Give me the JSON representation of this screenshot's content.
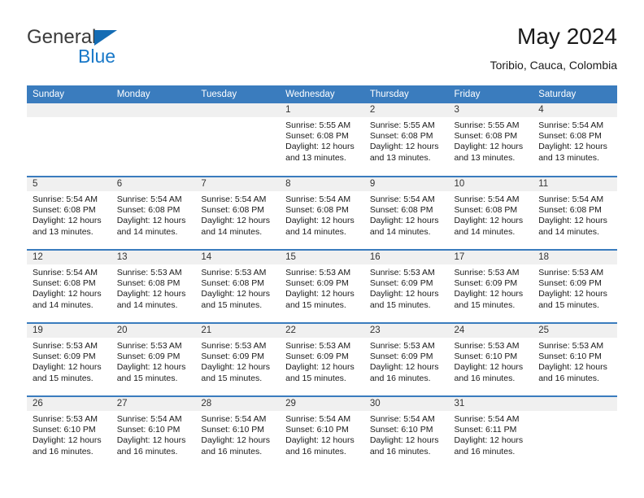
{
  "brand": {
    "name_top": "General",
    "name_bottom": "Blue",
    "triangle_color": "#146cb4",
    "blue_color": "#1878c8"
  },
  "header": {
    "title": "May 2024",
    "subtitle": "Toribio, Cauca, Colombia"
  },
  "theme": {
    "header_bg": "#3a7cbe",
    "header_text": "#ffffff",
    "daynum_bg": "#f0f0f0",
    "cell_bg": "#ffffff"
  },
  "weekdays": [
    "Sunday",
    "Monday",
    "Tuesday",
    "Wednesday",
    "Thursday",
    "Friday",
    "Saturday"
  ],
  "weeks": [
    [
      {
        "day": "",
        "empty": true
      },
      {
        "day": "",
        "empty": true
      },
      {
        "day": "",
        "empty": true
      },
      {
        "day": "1",
        "sunrise": "Sunrise: 5:55 AM",
        "sunset": "Sunset: 6:08 PM",
        "daylight1": "Daylight: 12 hours",
        "daylight2": "and 13 minutes."
      },
      {
        "day": "2",
        "sunrise": "Sunrise: 5:55 AM",
        "sunset": "Sunset: 6:08 PM",
        "daylight1": "Daylight: 12 hours",
        "daylight2": "and 13 minutes."
      },
      {
        "day": "3",
        "sunrise": "Sunrise: 5:55 AM",
        "sunset": "Sunset: 6:08 PM",
        "daylight1": "Daylight: 12 hours",
        "daylight2": "and 13 minutes."
      },
      {
        "day": "4",
        "sunrise": "Sunrise: 5:54 AM",
        "sunset": "Sunset: 6:08 PM",
        "daylight1": "Daylight: 12 hours",
        "daylight2": "and 13 minutes."
      }
    ],
    [
      {
        "day": "5",
        "sunrise": "Sunrise: 5:54 AM",
        "sunset": "Sunset: 6:08 PM",
        "daylight1": "Daylight: 12 hours",
        "daylight2": "and 13 minutes."
      },
      {
        "day": "6",
        "sunrise": "Sunrise: 5:54 AM",
        "sunset": "Sunset: 6:08 PM",
        "daylight1": "Daylight: 12 hours",
        "daylight2": "and 14 minutes."
      },
      {
        "day": "7",
        "sunrise": "Sunrise: 5:54 AM",
        "sunset": "Sunset: 6:08 PM",
        "daylight1": "Daylight: 12 hours",
        "daylight2": "and 14 minutes."
      },
      {
        "day": "8",
        "sunrise": "Sunrise: 5:54 AM",
        "sunset": "Sunset: 6:08 PM",
        "daylight1": "Daylight: 12 hours",
        "daylight2": "and 14 minutes."
      },
      {
        "day": "9",
        "sunrise": "Sunrise: 5:54 AM",
        "sunset": "Sunset: 6:08 PM",
        "daylight1": "Daylight: 12 hours",
        "daylight2": "and 14 minutes."
      },
      {
        "day": "10",
        "sunrise": "Sunrise: 5:54 AM",
        "sunset": "Sunset: 6:08 PM",
        "daylight1": "Daylight: 12 hours",
        "daylight2": "and 14 minutes."
      },
      {
        "day": "11",
        "sunrise": "Sunrise: 5:54 AM",
        "sunset": "Sunset: 6:08 PM",
        "daylight1": "Daylight: 12 hours",
        "daylight2": "and 14 minutes."
      }
    ],
    [
      {
        "day": "12",
        "sunrise": "Sunrise: 5:54 AM",
        "sunset": "Sunset: 6:08 PM",
        "daylight1": "Daylight: 12 hours",
        "daylight2": "and 14 minutes."
      },
      {
        "day": "13",
        "sunrise": "Sunrise: 5:53 AM",
        "sunset": "Sunset: 6:08 PM",
        "daylight1": "Daylight: 12 hours",
        "daylight2": "and 14 minutes."
      },
      {
        "day": "14",
        "sunrise": "Sunrise: 5:53 AM",
        "sunset": "Sunset: 6:08 PM",
        "daylight1": "Daylight: 12 hours",
        "daylight2": "and 15 minutes."
      },
      {
        "day": "15",
        "sunrise": "Sunrise: 5:53 AM",
        "sunset": "Sunset: 6:09 PM",
        "daylight1": "Daylight: 12 hours",
        "daylight2": "and 15 minutes."
      },
      {
        "day": "16",
        "sunrise": "Sunrise: 5:53 AM",
        "sunset": "Sunset: 6:09 PM",
        "daylight1": "Daylight: 12 hours",
        "daylight2": "and 15 minutes."
      },
      {
        "day": "17",
        "sunrise": "Sunrise: 5:53 AM",
        "sunset": "Sunset: 6:09 PM",
        "daylight1": "Daylight: 12 hours",
        "daylight2": "and 15 minutes."
      },
      {
        "day": "18",
        "sunrise": "Sunrise: 5:53 AM",
        "sunset": "Sunset: 6:09 PM",
        "daylight1": "Daylight: 12 hours",
        "daylight2": "and 15 minutes."
      }
    ],
    [
      {
        "day": "19",
        "sunrise": "Sunrise: 5:53 AM",
        "sunset": "Sunset: 6:09 PM",
        "daylight1": "Daylight: 12 hours",
        "daylight2": "and 15 minutes."
      },
      {
        "day": "20",
        "sunrise": "Sunrise: 5:53 AM",
        "sunset": "Sunset: 6:09 PM",
        "daylight1": "Daylight: 12 hours",
        "daylight2": "and 15 minutes."
      },
      {
        "day": "21",
        "sunrise": "Sunrise: 5:53 AM",
        "sunset": "Sunset: 6:09 PM",
        "daylight1": "Daylight: 12 hours",
        "daylight2": "and 15 minutes."
      },
      {
        "day": "22",
        "sunrise": "Sunrise: 5:53 AM",
        "sunset": "Sunset: 6:09 PM",
        "daylight1": "Daylight: 12 hours",
        "daylight2": "and 15 minutes."
      },
      {
        "day": "23",
        "sunrise": "Sunrise: 5:53 AM",
        "sunset": "Sunset: 6:09 PM",
        "daylight1": "Daylight: 12 hours",
        "daylight2": "and 16 minutes."
      },
      {
        "day": "24",
        "sunrise": "Sunrise: 5:53 AM",
        "sunset": "Sunset: 6:10 PM",
        "daylight1": "Daylight: 12 hours",
        "daylight2": "and 16 minutes."
      },
      {
        "day": "25",
        "sunrise": "Sunrise: 5:53 AM",
        "sunset": "Sunset: 6:10 PM",
        "daylight1": "Daylight: 12 hours",
        "daylight2": "and 16 minutes."
      }
    ],
    [
      {
        "day": "26",
        "sunrise": "Sunrise: 5:53 AM",
        "sunset": "Sunset: 6:10 PM",
        "daylight1": "Daylight: 12 hours",
        "daylight2": "and 16 minutes."
      },
      {
        "day": "27",
        "sunrise": "Sunrise: 5:54 AM",
        "sunset": "Sunset: 6:10 PM",
        "daylight1": "Daylight: 12 hours",
        "daylight2": "and 16 minutes."
      },
      {
        "day": "28",
        "sunrise": "Sunrise: 5:54 AM",
        "sunset": "Sunset: 6:10 PM",
        "daylight1": "Daylight: 12 hours",
        "daylight2": "and 16 minutes."
      },
      {
        "day": "29",
        "sunrise": "Sunrise: 5:54 AM",
        "sunset": "Sunset: 6:10 PM",
        "daylight1": "Daylight: 12 hours",
        "daylight2": "and 16 minutes."
      },
      {
        "day": "30",
        "sunrise": "Sunrise: 5:54 AM",
        "sunset": "Sunset: 6:10 PM",
        "daylight1": "Daylight: 12 hours",
        "daylight2": "and 16 minutes."
      },
      {
        "day": "31",
        "sunrise": "Sunrise: 5:54 AM",
        "sunset": "Sunset: 6:11 PM",
        "daylight1": "Daylight: 12 hours",
        "daylight2": "and 16 minutes."
      },
      {
        "day": "",
        "empty": true
      }
    ]
  ]
}
